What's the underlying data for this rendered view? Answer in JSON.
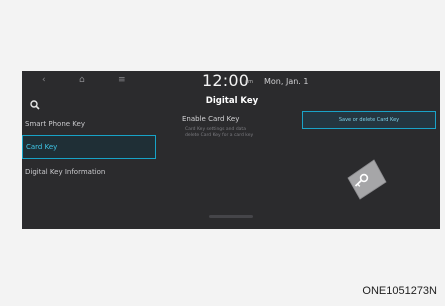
{
  "status_bar": {
    "time": "12:00",
    "ampm": "am",
    "date": "Mon, Jan. 1"
  },
  "page": {
    "title": "Digital Key"
  },
  "menu": {
    "items": [
      {
        "label": "Smart Phone Key"
      },
      {
        "label": "Card Key"
      },
      {
        "label": "Digital Key Information"
      }
    ]
  },
  "content": {
    "enable_label": "Enable Card Key",
    "description": "Card Key settings and data\ndelete Card Key for a card key",
    "action_button": "Save or delete Card Key"
  },
  "caption": "ONE1051273N",
  "colors": {
    "screen_bg": "#2b2b2d",
    "accent": "#17a3c7"
  },
  "icons": [
    "back-icon",
    "home-icon",
    "menu-icon",
    "search-icon",
    "key-card-icon"
  ]
}
